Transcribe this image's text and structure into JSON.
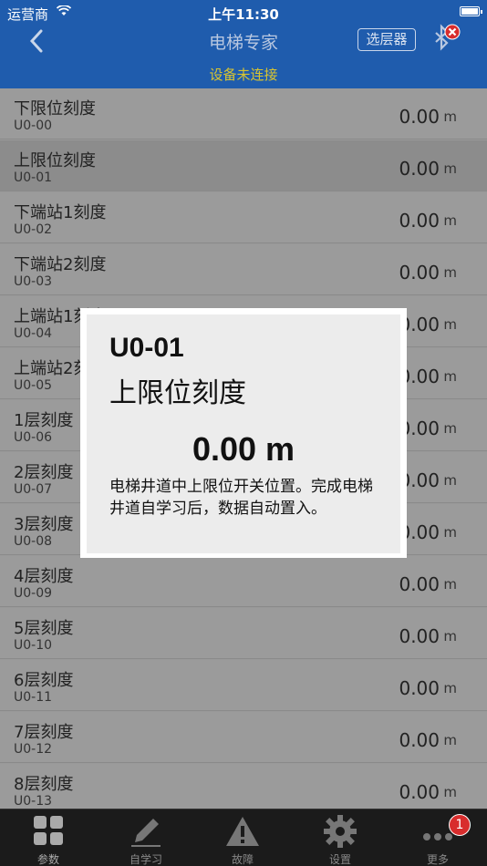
{
  "status_bar": {
    "carrier": "运营商",
    "time": "上午11:30"
  },
  "nav": {
    "title": "电梯专家",
    "selector_label": "选层器",
    "connection_status": "设备未连接"
  },
  "params": [
    {
      "name": "下限位刻度",
      "code": "U0-00",
      "value": "0.00",
      "unit": "m"
    },
    {
      "name": "上限位刻度",
      "code": "U0-01",
      "value": "0.00",
      "unit": "m"
    },
    {
      "name": "下端站1刻度",
      "code": "U0-02",
      "value": "0.00",
      "unit": "m"
    },
    {
      "name": "下端站2刻度",
      "code": "U0-03",
      "value": "0.00",
      "unit": "m"
    },
    {
      "name": "上端站1刻度",
      "code": "U0-04",
      "value": "0.00",
      "unit": "m"
    },
    {
      "name": "上端站2刻度",
      "code": "U0-05",
      "value": "0.00",
      "unit": "m"
    },
    {
      "name": "1层刻度",
      "code": "U0-06",
      "value": "0.00",
      "unit": "m"
    },
    {
      "name": "2层刻度",
      "code": "U0-07",
      "value": "0.00",
      "unit": "m"
    },
    {
      "name": "3层刻度",
      "code": "U0-08",
      "value": "0.00",
      "unit": "m"
    },
    {
      "name": "4层刻度",
      "code": "U0-09",
      "value": "0.00",
      "unit": "m"
    },
    {
      "name": "5层刻度",
      "code": "U0-10",
      "value": "0.00",
      "unit": "m"
    },
    {
      "name": "6层刻度",
      "code": "U0-11",
      "value": "0.00",
      "unit": "m"
    },
    {
      "name": "7层刻度",
      "code": "U0-12",
      "value": "0.00",
      "unit": "m"
    },
    {
      "name": "8层刻度",
      "code": "U0-13",
      "value": "0.00",
      "unit": "m"
    }
  ],
  "dialog": {
    "code": "U0-01",
    "name": "上限位刻度",
    "value": "0.00 m",
    "description": "电梯井道中上限位开关位置。完成电梯井道自学习后，数据自动置入。"
  },
  "tabs": [
    {
      "label": "参数",
      "icon": "grid-icon"
    },
    {
      "label": "自学习",
      "icon": "pencil-icon"
    },
    {
      "label": "故障",
      "icon": "warning-icon"
    },
    {
      "label": "设置",
      "icon": "gear-icon"
    },
    {
      "label": "更多",
      "icon": "more-dots-icon"
    }
  ],
  "more_badge": "1",
  "colors": {
    "nav_bg": "#1f5cad",
    "status_yellow": "#d8c431",
    "list_bg": "#9b9b9b",
    "badge_red": "#d82d2d"
  }
}
